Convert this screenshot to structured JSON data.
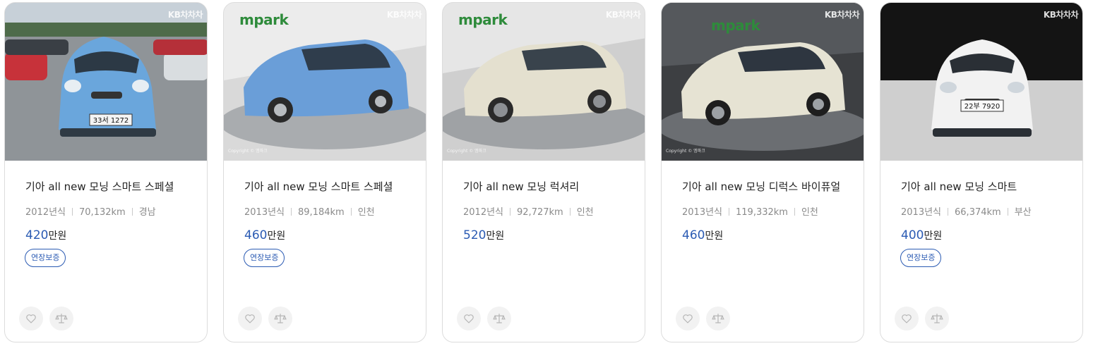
{
  "listings": [
    {
      "title": "기아 all new 모닝 스마트 스페셜",
      "year": "2012년식",
      "mileage": "70,132km",
      "region": "경남",
      "price": "420",
      "price_unit": "만원",
      "badge": "연장보증",
      "watermark": "KB차차차",
      "plate": "33서 1272",
      "car_color": "#6aa6dc"
    },
    {
      "title": "기아 all new 모닝 스마트 스페셜",
      "year": "2013년식",
      "mileage": "89,184km",
      "region": "인천",
      "price": "460",
      "price_unit": "만원",
      "badge": "연장보증",
      "watermark": "KB차차차",
      "brand_logo": "mpark",
      "copyright": "Copyright © 엠파크",
      "car_color": "#6a9ed8"
    },
    {
      "title": "기아 all new 모닝 럭셔리",
      "year": "2012년식",
      "mileage": "92,727km",
      "region": "인천",
      "price": "520",
      "price_unit": "만원",
      "watermark": "KB차차차",
      "brand_logo": "mpark",
      "copyright": "Copyright © 엠파크",
      "car_color": "#e4e0cf"
    },
    {
      "title": "기아 all new 모닝 디럭스 바이퓨얼",
      "year": "2013년식",
      "mileage": "119,332km",
      "region": "인천",
      "price": "460",
      "price_unit": "만원",
      "watermark": "KB차차차",
      "brand_logo": "mpark",
      "copyright": "Copyright © 엠파크",
      "car_color": "#e6e3d3"
    },
    {
      "title": "기아 all new 모닝 스마트",
      "year": "2013년식",
      "mileage": "66,374km",
      "region": "부산",
      "price": "400",
      "price_unit": "만원",
      "badge": "연장보증",
      "watermark": "KB차차차",
      "plate": "22부 7920",
      "car_color": "#f2f2f2"
    }
  ],
  "icons": {
    "favorite": "heart-icon",
    "compare": "scale-icon"
  },
  "colors": {
    "accent": "#2b5bb3",
    "mpark_green": "#2e8b3b"
  }
}
